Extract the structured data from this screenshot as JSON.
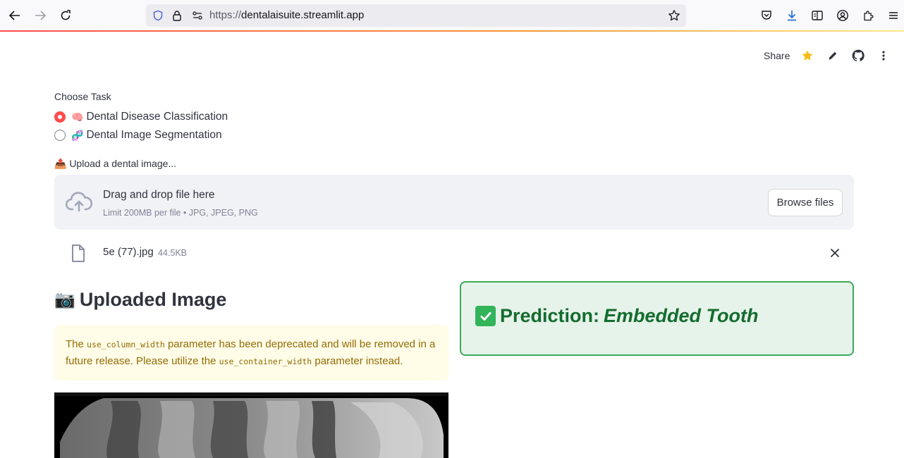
{
  "browser": {
    "url_scheme": "https://",
    "url_host": "dentalaisuite.streamlit.app"
  },
  "header": {
    "share_label": "Share"
  },
  "task": {
    "label": "Choose Task",
    "options": [
      {
        "emoji": "🧠",
        "label": "Dental Disease Classification",
        "selected": true
      },
      {
        "emoji": "🧬",
        "label": "Dental Image Segmentation",
        "selected": false
      }
    ]
  },
  "uploader": {
    "label": "📤 Upload a dental image...",
    "drop_title": "Drag and drop file here",
    "drop_subtitle": "Limit 200MB per file • JPG, JPEG, PNG",
    "browse_label": "Browse files"
  },
  "file": {
    "name": "5e (77).jpg",
    "size": "44.5KB"
  },
  "uploaded_section": {
    "emoji": "📷",
    "title": "Uploaded Image"
  },
  "warning": {
    "part1": "The ",
    "code1": "use_column_width",
    "part2": " parameter has been deprecated and will be removed in a future release. Please utilize the ",
    "code2": "use_container_width",
    "part3": " parameter instead."
  },
  "prediction": {
    "label": "Prediction: ",
    "value": "Embedded Tooth"
  },
  "colors": {
    "accent": "#ff4b4b",
    "success_border": "#3caa5a",
    "warning_text": "#926c05"
  }
}
